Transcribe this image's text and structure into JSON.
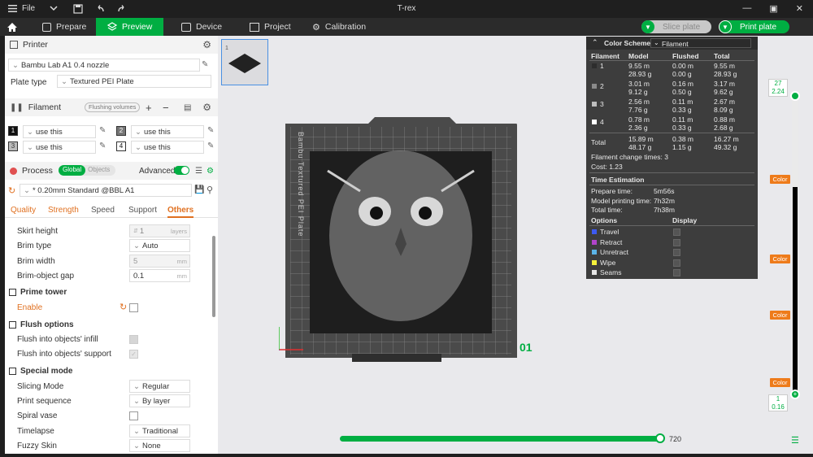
{
  "titlebar": {
    "menu_label": "File",
    "title": "T-rex"
  },
  "tabs": {
    "prepare": "Prepare",
    "preview": "Preview",
    "device": "Device",
    "project": "Project",
    "calibration": "Calibration"
  },
  "toolbar": {
    "slice_plate": "Slice plate",
    "print_plate": "Print plate"
  },
  "printer": {
    "section_title": "Printer",
    "model": "Bambu Lab A1 0.4 nozzle",
    "plate_type_label": "Plate type",
    "plate_type": "Textured PEI Plate"
  },
  "filament": {
    "section_title": "Filament",
    "flushing_volumes": "Flushing volumes",
    "slots": [
      {
        "num": "1",
        "value": "use this"
      },
      {
        "num": "2",
        "value": "use this"
      },
      {
        "num": "3",
        "value": "use this"
      },
      {
        "num": "4",
        "value": "use this"
      }
    ]
  },
  "process": {
    "section_title": "Process",
    "global": "Global",
    "objects": "Objects",
    "advanced": "Advanced",
    "preset": "* 0.20mm Standard @BBL A1",
    "tabs": [
      "Quality",
      "Strength",
      "Speed",
      "Support",
      "Others"
    ]
  },
  "settings": {
    "skirt_height_label": "Skirt height",
    "skirt_height": "1",
    "skirt_height_unit": "layers",
    "brim_type_label": "Brim type",
    "brim_type": "Auto",
    "brim_width_label": "Brim width",
    "brim_width": "5",
    "brim_width_unit": "mm",
    "brim_gap_label": "Brim-object gap",
    "brim_gap": "0.1",
    "brim_gap_unit": "mm",
    "prime_tower_title": "Prime tower",
    "enable_label": "Enable",
    "flush_options_title": "Flush options",
    "flush_infill_label": "Flush into objects' infill",
    "flush_support_label": "Flush into objects' support",
    "special_mode_title": "Special mode",
    "slicing_mode_label": "Slicing Mode",
    "slicing_mode": "Regular",
    "print_sequence_label": "Print sequence",
    "print_sequence": "By layer",
    "spiral_vase_label": "Spiral vase",
    "timelapse_label": "Timelapse",
    "timelapse": "Traditional",
    "fuzzy_skin_label": "Fuzzy Skin",
    "fuzzy_skin": "None"
  },
  "plate": {
    "number": "01",
    "bed_label": "Bambu Textured PEI Plate"
  },
  "legend": {
    "title": "Color Scheme",
    "scheme": "Filament",
    "columns": [
      "Filament",
      "Model",
      "Flushed",
      "Total"
    ],
    "rows": [
      {
        "id": "1",
        "color": "#2d2d2d",
        "model_m": "9.55 m",
        "model_g": "28.93 g",
        "flushed_m": "0.00 m",
        "flushed_g": "0.00 g",
        "total_m": "9.55 m",
        "total_g": "28.93 g"
      },
      {
        "id": "2",
        "color": "#8a8a8a",
        "model_m": "3.01 m",
        "model_g": "9.12 g",
        "flushed_m": "0.16 m",
        "flushed_g": "0.50 g",
        "total_m": "3.17 m",
        "total_g": "9.62 g"
      },
      {
        "id": "3",
        "color": "#bdbdbd",
        "model_m": "2.56 m",
        "model_g": "7.76 g",
        "flushed_m": "0.11 m",
        "flushed_g": "0.33 g",
        "total_m": "2.67 m",
        "total_g": "8.09 g"
      },
      {
        "id": "4",
        "color": "#ffffff",
        "model_m": "0.78 m",
        "model_g": "2.36 g",
        "flushed_m": "0.11 m",
        "flushed_g": "0.33 g",
        "total_m": "0.88 m",
        "total_g": "2.68 g"
      }
    ],
    "total": {
      "label": "Total",
      "model_m": "15.89 m",
      "model_g": "48.17 g",
      "flushed_m": "0.38 m",
      "flushed_g": "1.15 g",
      "total_m": "16.27 m",
      "total_g": "49.32 g"
    },
    "change_times": "Filament change times:  3",
    "cost": "Cost:  1.23",
    "time_title": "Time Estimation",
    "prepare_label": "Prepare time:",
    "prepare": "5m56s",
    "model_time_label": "Model printing time:",
    "model_time": "7h32m",
    "total_time_label": "Total time:",
    "total_time": "7h38m",
    "options_label": "Options",
    "display_label": "Display",
    "options": [
      {
        "name": "Travel",
        "color": "#3d5af1"
      },
      {
        "name": "Retract",
        "color": "#b144c9"
      },
      {
        "name": "Unretract",
        "color": "#5bb4e8"
      },
      {
        "name": "Wipe",
        "color": "#f4f13b"
      },
      {
        "name": "Seams",
        "color": "#e6e6e6"
      }
    ]
  },
  "layers": {
    "top_layer": "27",
    "top_height": "2.24",
    "bottom_layer": "1",
    "bottom_height": "0.16",
    "color_label": "Color"
  },
  "moves": {
    "count": "720",
    "position": 1.0
  }
}
